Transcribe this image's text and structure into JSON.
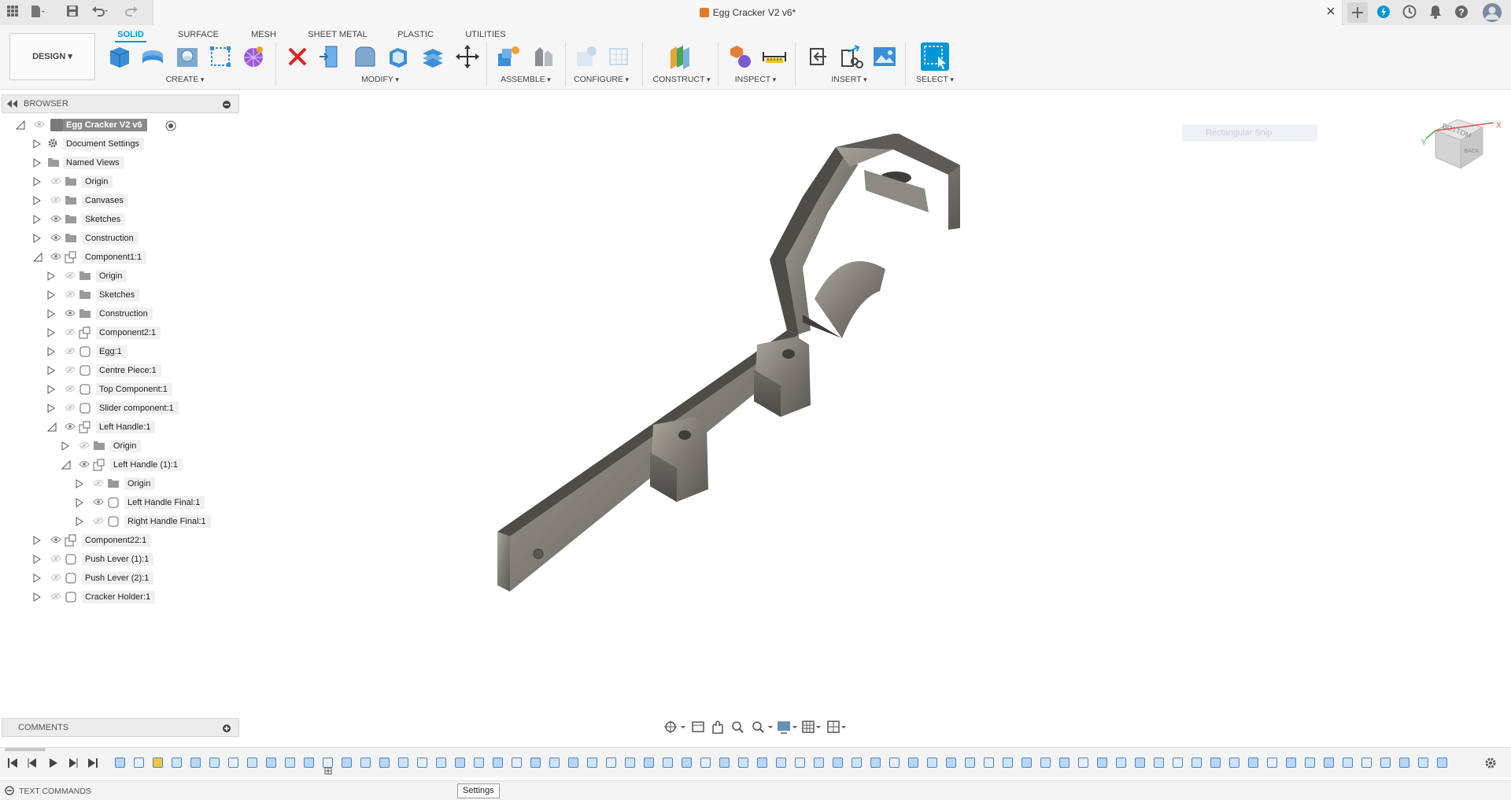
{
  "app": {
    "doc_title": "Egg Cracker V2 v6*"
  },
  "ribbon": {
    "workspace": "DESIGN",
    "tabs": [
      "SOLID",
      "SURFACE",
      "MESH",
      "SHEET METAL",
      "PLASTIC",
      "UTILITIES"
    ],
    "groups": {
      "create": "CREATE",
      "modify": "MODIFY",
      "assemble": "ASSEMBLE",
      "configure": "CONFIGURE",
      "construct": "CONSTRUCT",
      "inspect": "INSPECT",
      "insert": "INSERT",
      "select": "SELECT"
    }
  },
  "browser": {
    "title": "BROWSER",
    "root": "Egg Cracker V2 v6",
    "items": [
      "Document Settings",
      "Named Views",
      "Origin",
      "Canvases",
      "Sketches",
      "Construction",
      "Component1:1",
      "Origin",
      "Sketches",
      "Construction",
      "Component2:1",
      "Egg:1",
      "Centre Piece:1",
      "Top Component:1",
      "Slider component:1",
      "Left Handle:1",
      "Origin",
      "Left Handle (1):1",
      "Origin",
      "Left Handle Final:1",
      "Right Handle Final:1",
      "Component22:1",
      "Push Lever (1):1",
      "Push Lever (2):1",
      "Cracker Holder:1"
    ]
  },
  "viewport": {
    "snip_label": "Rectangular Snip",
    "viewcube_faces": [
      "BOTTOM",
      "BACK"
    ],
    "axis_labels": [
      "X",
      "Y"
    ]
  },
  "comments": {
    "title": "COMMENTS"
  },
  "text_commands": {
    "title": "TEXT COMMANDS"
  },
  "tooltip": "Settings",
  "colors": {
    "accent": "#0696d7",
    "delete": "#e02020",
    "model": "#8c8a82"
  }
}
